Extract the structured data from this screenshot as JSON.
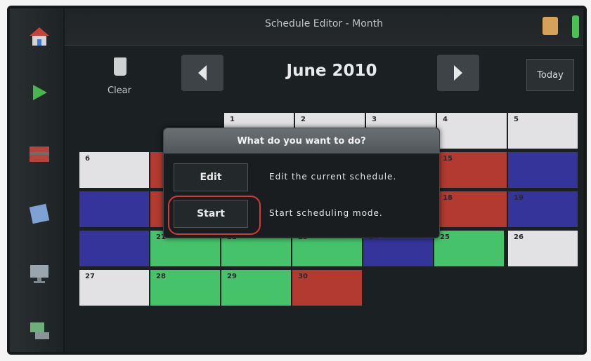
{
  "titlebar": {
    "title": "Schedule Editor - Month"
  },
  "toolbar": {
    "clear_label": "Clear",
    "month_label": "June 2010",
    "today_label": "Today"
  },
  "calendar": {
    "cells": [
      {
        "day": "1"
      },
      {
        "day": "2"
      },
      {
        "day": "3"
      },
      {
        "day": "4"
      },
      {
        "day": "5"
      },
      {
        "day": "6"
      },
      {
        "day": "15"
      },
      {
        "day": "18"
      },
      {
        "day": "19"
      },
      {
        "day": "21"
      },
      {
        "day": "22"
      },
      {
        "day": "23"
      },
      {
        "day": "24"
      },
      {
        "day": "25"
      },
      {
        "day": "26"
      },
      {
        "day": "27"
      },
      {
        "day": "28"
      },
      {
        "day": "29"
      },
      {
        "day": "30"
      }
    ]
  },
  "dialog": {
    "title": "What do you want to do?",
    "edit_label": "Edit",
    "edit_desc": "Edit the current schedule.",
    "start_label": "Start",
    "start_desc": "Start scheduling mode."
  },
  "colors": {
    "white": "#e2e2e4",
    "red": "#b23a30",
    "blue": "#35349a",
    "green": "#46c36a"
  }
}
